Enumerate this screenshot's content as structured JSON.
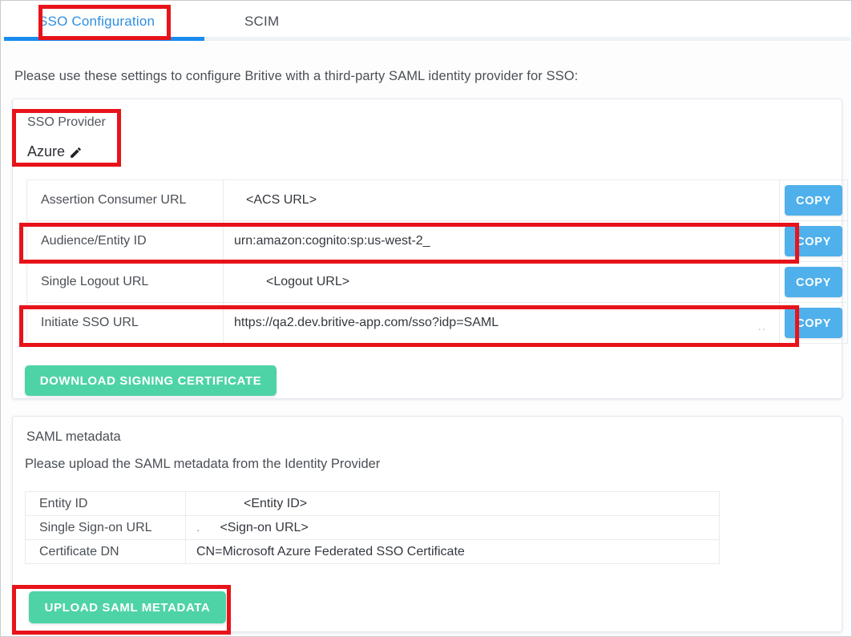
{
  "tabs": [
    {
      "label": "SSO Configuration",
      "active": true
    },
    {
      "label": "SCIM",
      "active": false
    }
  ],
  "intro_text": "Please use these settings to configure Britive with a third-party SAML identity provider for SSO:",
  "sso_provider": {
    "label": "SSO Provider",
    "value": "Azure",
    "edit_icon": "pencil-icon"
  },
  "settings_table": {
    "copy_label": "COPY",
    "rows": [
      {
        "key": "Assertion Consumer URL",
        "value": "<ACS URL>",
        "copy_label": "COPY"
      },
      {
        "key": "Audience/Entity ID",
        "value": "urn:amazon:cognito:sp:us-west-2_",
        "copy_label": "COPY"
      },
      {
        "key": "Single Logout URL",
        "value": "<Logout URL>",
        "copy_label": "COPY"
      },
      {
        "key": "Initiate SSO URL",
        "value": "https://qa2.dev.britive-app.com/sso?idp=SAML",
        "trailing": "..",
        "copy_label": "COPY"
      }
    ]
  },
  "download_cert_label": "DOWNLOAD SIGNING CERTIFICATE",
  "metadata": {
    "title": "SAML metadata",
    "subtitle": "Please upload the SAML metadata from the Identity Provider",
    "rows": [
      {
        "key": "Entity ID",
        "value": "<Entity ID>"
      },
      {
        "key": "Single Sign-on URL",
        "value": "<Sign-on URL>",
        "leading": "."
      },
      {
        "key": "Certificate DN",
        "value": "CN=Microsoft Azure Federated SSO Certificate"
      }
    ],
    "upload_label": "UPLOAD SAML METADATA"
  },
  "colors": {
    "tab_active": "#2f8fe0",
    "tab_indicator": "#1a8cf0",
    "copy_button": "#4fb0ec",
    "green_button": "#4ed3a6",
    "annotation": "#e8131a"
  }
}
